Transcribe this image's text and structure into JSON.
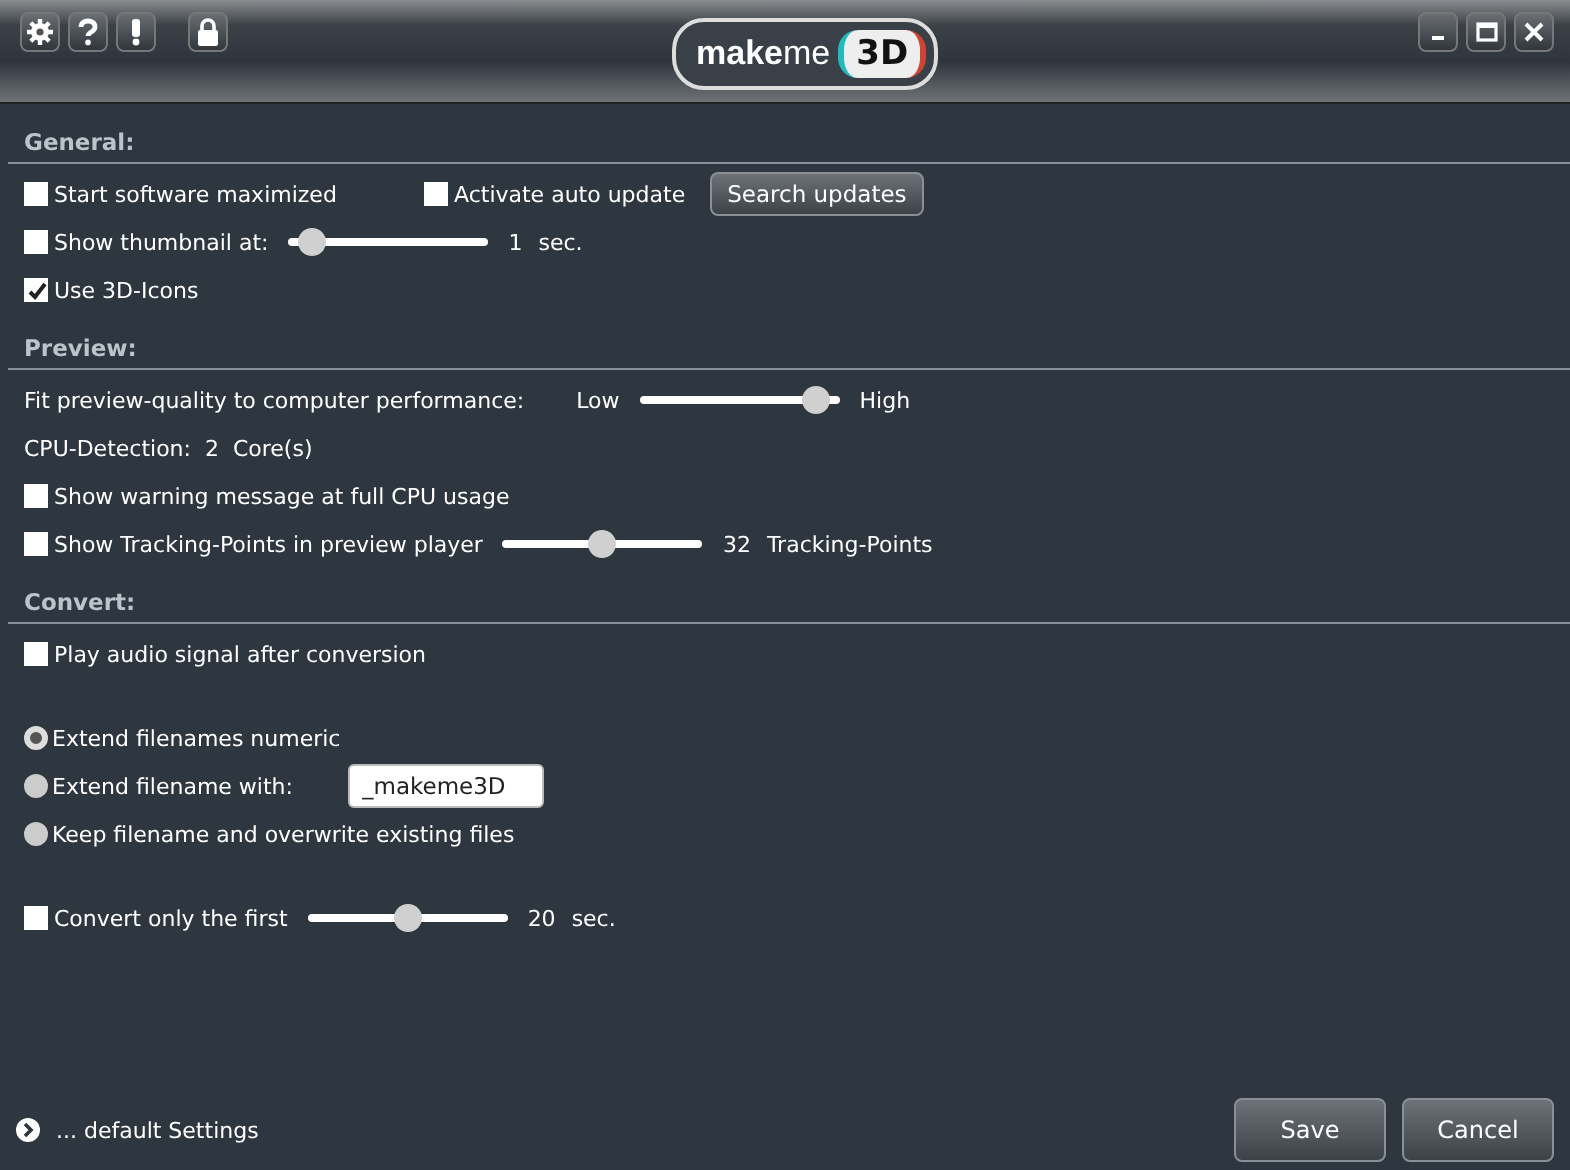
{
  "logo": {
    "word": "**make**me",
    "badge": "3D"
  },
  "sections": [
    {
      "title": "General:",
      "groups": [
        [
          {
            "kind": "check-pair",
            "items": [
              {
                "label": "Start software maximized",
                "checked": false
              },
              {
                "label": "Activate auto update",
                "checked": false
              }
            ],
            "button": "Search updates"
          },
          {
            "kind": "check-slider",
            "label": "Show thumbnail at:",
            "checked": false,
            "level": 0.05,
            "value": "1",
            "unit": "sec."
          },
          {
            "kind": "check",
            "label": "Use 3D-Icons",
            "checked": true
          }
        ]
      ]
    },
    {
      "title": "Preview:",
      "groups": [
        [
          {
            "kind": "quality",
            "label": "Fit preview-quality to computer performance:",
            "low": "Low",
            "high": "High",
            "level": 0.95
          },
          {
            "kind": "text",
            "label": "CPU-Detection:  2  Core(s)"
          },
          {
            "kind": "check",
            "label": "Show warning message at full CPU usage",
            "checked": false
          },
          {
            "kind": "check-slider",
            "label": "Show Tracking-Points in preview player",
            "checked": false,
            "level": 0.5,
            "value": "32",
            "unit": "Tracking-Points"
          }
        ]
      ]
    },
    {
      "title": "Convert:",
      "groups": [
        [
          {
            "kind": "check",
            "label": "Play audio signal after conversion",
            "checked": false
          }
        ],
        [
          {
            "kind": "radio",
            "label": "Extend filenames numeric",
            "selected": true
          },
          {
            "kind": "radio",
            "label": "Extend filename with:",
            "selected": false,
            "field": "_makeme3D"
          },
          {
            "kind": "radio",
            "label": "Keep filename and overwrite existing files",
            "selected": false
          }
        ],
        [
          {
            "kind": "check-slider",
            "label": "Convert only the first",
            "checked": false,
            "level": 0.5,
            "value": "20",
            "unit": "sec."
          }
        ]
      ]
    }
  ],
  "footer": {
    "link": "... default Settings",
    "buttons": [
      "Save",
      "Cancel"
    ]
  }
}
